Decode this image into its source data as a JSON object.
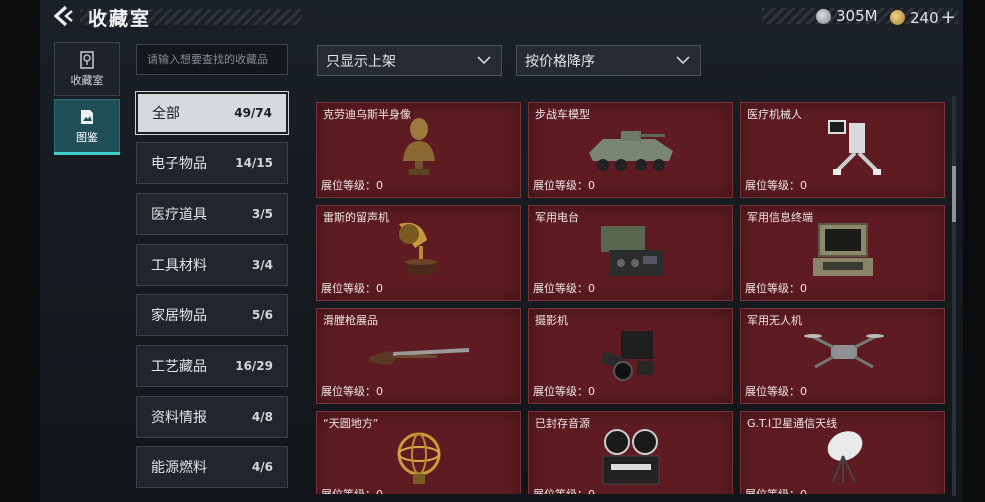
{
  "header": {
    "title": "收藏室",
    "currency_silver": "305M",
    "currency_gold": "240",
    "plus": "+"
  },
  "sidebar_tabs": [
    {
      "label": "收藏室",
      "icon": "collection-room-icon"
    },
    {
      "label": "图鉴",
      "icon": "catalog-icon"
    }
  ],
  "search": {
    "placeholder": "请输入想要查找的收藏品"
  },
  "filters": {
    "shelf_filter": "只显示上架",
    "sort": "按价格降序"
  },
  "categories": [
    {
      "name": "全部",
      "count": "49/74"
    },
    {
      "name": "电子物品",
      "count": "14/15"
    },
    {
      "name": "医疗道具",
      "count": "3/5"
    },
    {
      "name": "工具材料",
      "count": "3/4"
    },
    {
      "name": "家居物品",
      "count": "5/6"
    },
    {
      "name": "工艺藏品",
      "count": "16/29"
    },
    {
      "name": "资料情报",
      "count": "4/8"
    },
    {
      "name": "能源燃料",
      "count": "4/6"
    }
  ],
  "level_label": "展位等级：0",
  "items": [
    {
      "name": "克劳迪乌斯半身像",
      "icon": "bust-icon"
    },
    {
      "name": "步战车模型",
      "icon": "armored-vehicle-icon"
    },
    {
      "name": "医疗机械人",
      "icon": "medical-robot-icon"
    },
    {
      "name": "雷斯的留声机",
      "icon": "gramophone-icon"
    },
    {
      "name": "军用电台",
      "icon": "military-radio-icon"
    },
    {
      "name": "军用信息终端",
      "icon": "info-terminal-icon"
    },
    {
      "name": "滑膛枪展品",
      "icon": "musket-icon"
    },
    {
      "name": "摄影机",
      "icon": "camera-icon"
    },
    {
      "name": "军用无人机",
      "icon": "drone-icon"
    },
    {
      "name": "“天圆地方”",
      "icon": "armillary-sphere-icon"
    },
    {
      "name": "已封存音源",
      "icon": "reel-recorder-icon"
    },
    {
      "name": "G.T.I卫星通信天线",
      "icon": "satellite-dish-icon"
    }
  ],
  "colors": {
    "accent": "#41d0c7",
    "card_bg": "#5e1c22",
    "active_tab": "#214f58"
  }
}
